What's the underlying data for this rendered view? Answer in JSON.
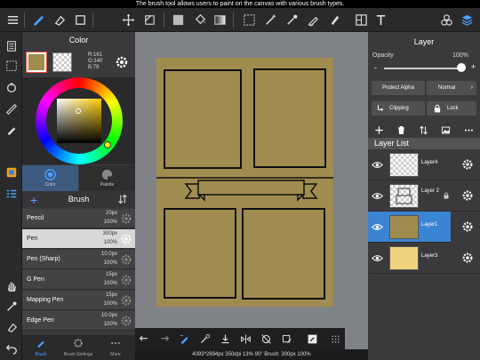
{
  "hint": "The brush tool allows users to paint on the canvas with various brush types.",
  "toolbar": {
    "icons": [
      "menu-icon",
      "brush-icon",
      "eraser-icon",
      "square-icon",
      "move-icon",
      "transform-icon",
      "fill-color-icon",
      "bucket-icon",
      "gradient-icon",
      "lasso-icon",
      "magic-wand-icon",
      "eyedropper-icon",
      "pen-fill-icon",
      "text-icon",
      "materials-icon",
      "layers-icon"
    ]
  },
  "color_panel": {
    "title": "Color",
    "rgb": {
      "r": "R:161",
      "g": "G:140",
      "b": "B:79"
    },
    "primary_color": "#a18c4f",
    "tabs": {
      "color": "Color",
      "palette": "Palette"
    }
  },
  "brush_panel": {
    "title": "Brush",
    "add": "+",
    "items": [
      {
        "name": "Pencil",
        "size": "20px",
        "opacity": "100%"
      },
      {
        "name": "Pen",
        "size": "300px",
        "opacity": "100%",
        "selected": true
      },
      {
        "name": "Pen (Sharp)",
        "size": "10.0px",
        "opacity": "100%"
      },
      {
        "name": "G Pen",
        "size": "15px",
        "opacity": "100%"
      },
      {
        "name": "Mapping Pen",
        "size": "15px",
        "opacity": "100%"
      },
      {
        "name": "Edge Pen",
        "size": "10.0px",
        "opacity": "100%"
      }
    ]
  },
  "bottom_tabs": {
    "brush": "Brush",
    "brush_settings": "Brush Settings",
    "more": "More"
  },
  "status": "4093*2894px 350dpi 13% 90° Brush: 300px 100%",
  "layer_panel": {
    "title": "Layer",
    "opacity_label": "Opacity",
    "opacity_value": "100%",
    "opacity_fraction": 1.0,
    "minus": "-",
    "plus": "+",
    "protect_alpha": "Protect Alpha",
    "blend_mode": "Normal",
    "clipping": "Clipping",
    "lock": "Lock",
    "list_title": "Layer List",
    "layers": [
      {
        "name": "Layer4",
        "thumb": "transparent"
      },
      {
        "name": "Layer 2",
        "thumb": "ribbon"
      },
      {
        "name": "Layer1",
        "thumb": "#a18c4f",
        "selected": true
      },
      {
        "name": "Layer3",
        "thumb": "#f1d27d"
      }
    ]
  }
}
